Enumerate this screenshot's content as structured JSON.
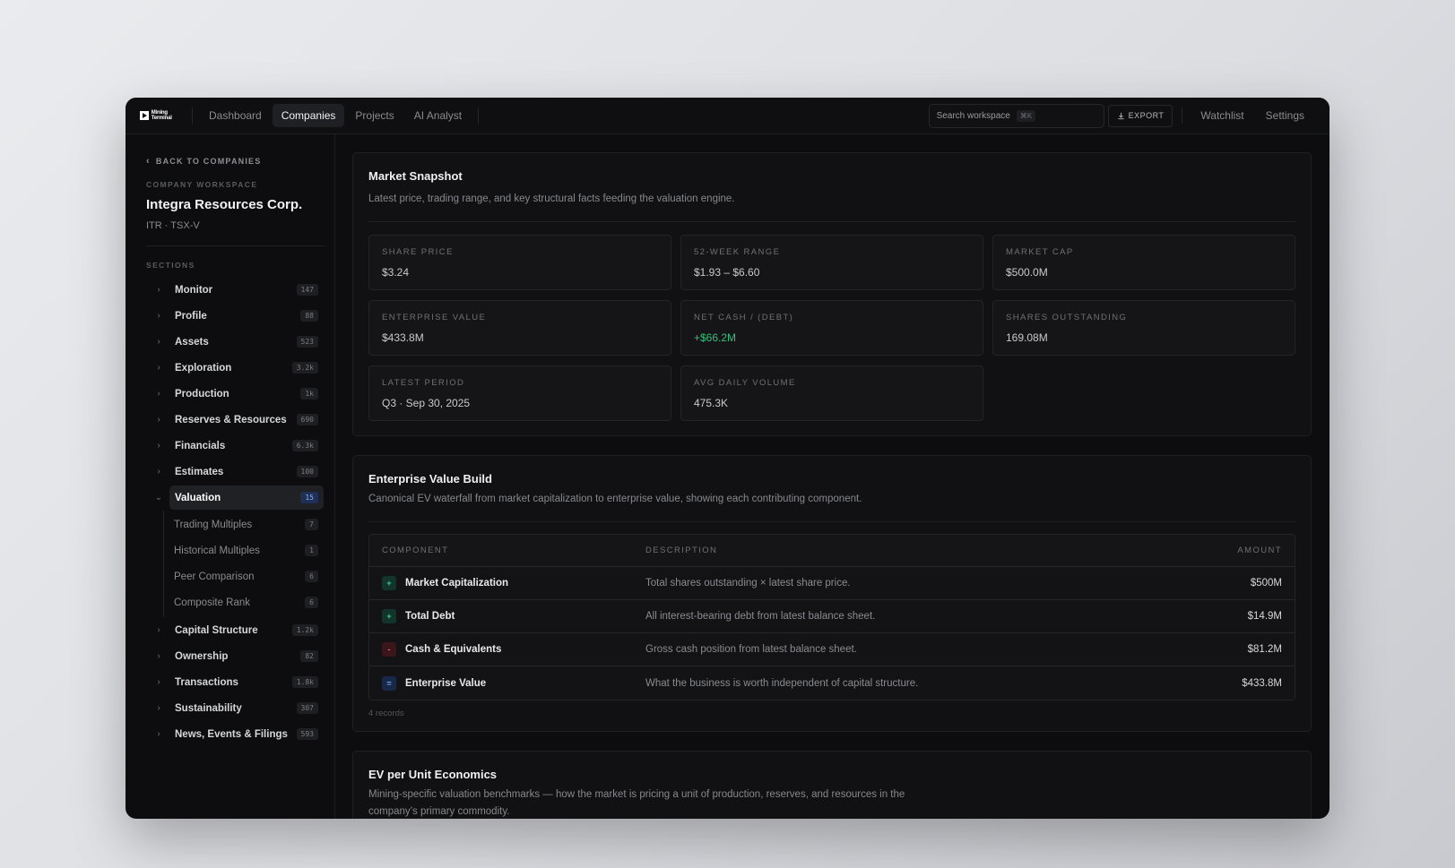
{
  "app": {
    "logo_text": "Mining Terminal",
    "nav": [
      {
        "label": "Dashboard"
      },
      {
        "label": "Companies"
      },
      {
        "label": "Projects"
      },
      {
        "label": "AI Analyst"
      }
    ],
    "search_placeholder": "Search workspace",
    "search_shortcut": "⌘K",
    "export_label": "EXPORT",
    "right_links": [
      {
        "label": "Watchlist"
      },
      {
        "label": "Settings"
      }
    ]
  },
  "sidebar": {
    "back_label": "BACK TO COMPANIES",
    "workspace_label": "COMPANY WORKSPACE",
    "company_name": "Integra Resources Corp.",
    "ticker": "ITR · TSX-V",
    "sections_label": "SECTIONS",
    "sections_before": [
      {
        "label": "Monitor",
        "count": "147"
      },
      {
        "label": "Profile",
        "count": "88"
      },
      {
        "label": "Assets",
        "count": "523"
      },
      {
        "label": "Exploration",
        "count": "3.2k"
      },
      {
        "label": "Production",
        "count": "1k"
      },
      {
        "label": "Reserves & Resources",
        "count": "690"
      },
      {
        "label": "Financials",
        "count": "6.3k"
      },
      {
        "label": "Estimates",
        "count": "100"
      }
    ],
    "active_section": {
      "label": "Valuation",
      "count": "15"
    },
    "subsections": [
      {
        "label": "Trading Multiples",
        "count": "7"
      },
      {
        "label": "Historical Multiples",
        "count": "1"
      },
      {
        "label": "Peer Comparison",
        "count": "6"
      },
      {
        "label": "Composite Rank",
        "count": "6"
      }
    ],
    "sections_after": [
      {
        "label": "Capital Structure",
        "count": "1.2k"
      },
      {
        "label": "Ownership",
        "count": "82"
      },
      {
        "label": "Transactions",
        "count": "1.8k"
      },
      {
        "label": "Sustainability",
        "count": "307"
      },
      {
        "label": "News, Events & Filings",
        "count": "593"
      }
    ]
  },
  "snapshot": {
    "title": "Market Snapshot",
    "subtitle": "Latest price, trading range, and key structural facts feeding the valuation engine.",
    "stats": [
      {
        "label": "SHARE PRICE",
        "value": "$3.24"
      },
      {
        "label": "52-WEEK RANGE",
        "value": "$1.93 – $6.60"
      },
      {
        "label": "MARKET CAP",
        "value": "$500.0M"
      },
      {
        "label": "ENTERPRISE VALUE",
        "value": "$433.8M"
      },
      {
        "label": "NET CASH / (DEBT)",
        "value": "+$66.2M"
      },
      {
        "label": "SHARES OUTSTANDING",
        "value": "169.08M"
      },
      {
        "label": "LATEST PERIOD",
        "value": "Q3 · Sep 30, 2025"
      },
      {
        "label": "AVG DAILY VOLUME",
        "value": "475.3K"
      }
    ],
    "positive_color": "#34c07f"
  },
  "ev_build": {
    "title": "Enterprise Value Build",
    "subtitle": "Canonical EV waterfall from market capitalization to enterprise value, showing each contributing component.",
    "columns": {
      "component": "COMPONENT",
      "description": "DESCRIPTION",
      "amount": "AMOUNT"
    },
    "rows": [
      {
        "sign": "+",
        "component": "Market Capitalization",
        "description": "Total shares outstanding × latest share price.",
        "amount": "$500M"
      },
      {
        "sign": "+",
        "component": "Total Debt",
        "description": "All interest-bearing debt from latest balance sheet.",
        "amount": "$14.9M"
      },
      {
        "sign": "-",
        "component": "Cash & Equivalents",
        "description": "Gross cash position from latest balance sheet.",
        "amount": "$81.2M"
      },
      {
        "sign": "=",
        "component": "Enterprise Value",
        "description": "What the business is worth independent of capital structure.",
        "amount": "$433.8M"
      }
    ],
    "records": "4 records"
  },
  "ev_unit": {
    "title": "EV per Unit Economics",
    "subtitle": "Mining-specific valuation benchmarks — how the market is pricing a unit of production, reserves, and resources in the company’s primary commodity."
  }
}
